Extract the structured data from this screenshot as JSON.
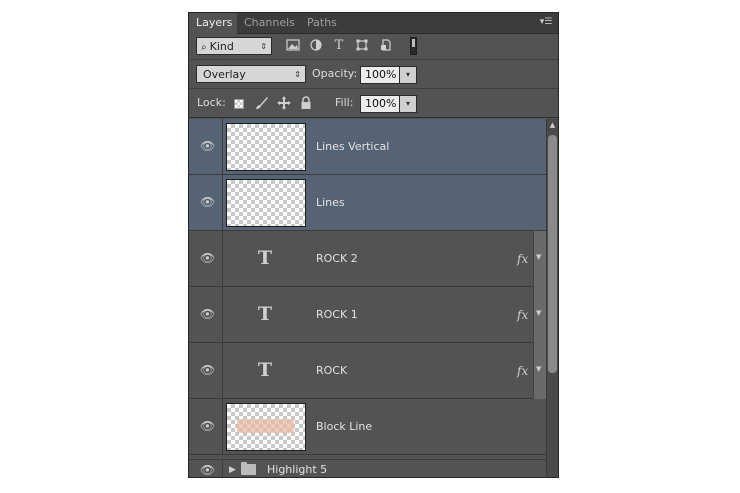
{
  "tabs": [
    {
      "label": "Layers",
      "active": true
    },
    {
      "label": "Channels",
      "active": false
    },
    {
      "label": "Paths",
      "active": false
    }
  ],
  "panel_menu_icon": "panel-menu-icon",
  "filter": {
    "kind_label": "Kind",
    "icons": [
      "pixel-filter-icon",
      "adjustment-filter-icon",
      "type-filter-icon",
      "shape-filter-icon",
      "smart-object-filter-icon"
    ]
  },
  "blend": {
    "mode": "Overlay",
    "opacity_label": "Opacity:",
    "opacity_value": "100%"
  },
  "lock": {
    "label": "Lock:",
    "icons": [
      "lock-transparent-icon",
      "lock-image-icon",
      "lock-position-icon",
      "lock-all-icon"
    ],
    "fill_label": "Fill:",
    "fill_value": "100%"
  },
  "layers": [
    {
      "name": "Lines Vertical",
      "type": "pixel",
      "selected": true,
      "fx": false
    },
    {
      "name": "Lines",
      "type": "pixel",
      "selected": true,
      "fx": false
    },
    {
      "name": "ROCK 2",
      "type": "text",
      "selected": false,
      "fx": true
    },
    {
      "name": "ROCK 1",
      "type": "text",
      "selected": false,
      "fx": true
    },
    {
      "name": "ROCK",
      "type": "text",
      "selected": false,
      "fx": true
    },
    {
      "name": "Block Line",
      "type": "pixel",
      "selected": false,
      "fx": false
    }
  ],
  "group": {
    "name": "Highlight 5",
    "expanded": false
  },
  "text_glyph": "T",
  "fx_label": "fx",
  "colors": {
    "panel": "#535353",
    "selected": "#566375",
    "tabbar": "#3c3c3c"
  }
}
